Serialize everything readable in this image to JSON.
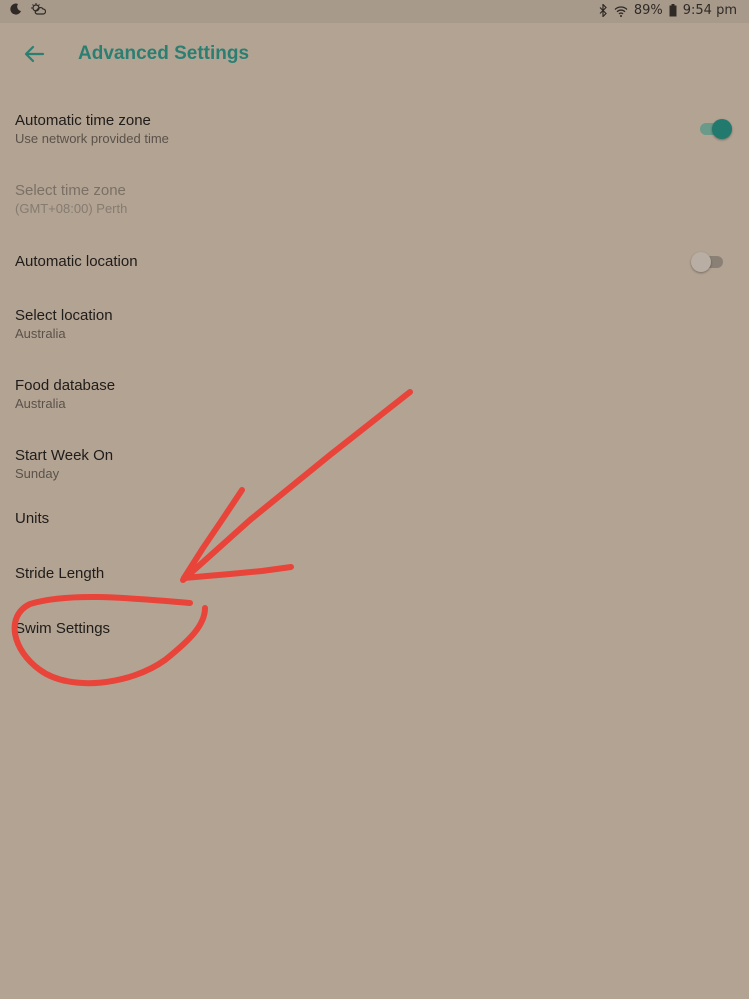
{
  "status_bar": {
    "left_icons": [
      "moon-icon",
      "weather-icon"
    ],
    "right_icons": [
      "bluetooth-icon",
      "wifi-icon",
      "battery-icon"
    ],
    "battery": "89%",
    "time": "9:54 pm"
  },
  "header": {
    "title": "Advanced Settings",
    "back_icon": "arrow-left-icon"
  },
  "settings": [
    {
      "label": "Automatic time zone",
      "sublabel": "Use network provided time",
      "toggle": "on"
    },
    {
      "label": "Select time zone",
      "sublabel": "(GMT+08:00) Perth",
      "disabled": true
    },
    {
      "label": "Automatic location",
      "toggle": "off"
    },
    {
      "label": "Select location",
      "sublabel": "Australia"
    },
    {
      "label": "Food database",
      "sublabel": "Australia"
    },
    {
      "label": "Start Week On",
      "sublabel": "Sunday"
    },
    {
      "label": "Units"
    },
    {
      "label": "Stride Length"
    },
    {
      "label": "Swim Settings"
    }
  ],
  "colors": {
    "accent": "#2a7f72",
    "background": "#b3a393",
    "annotation": "#e8443a"
  }
}
